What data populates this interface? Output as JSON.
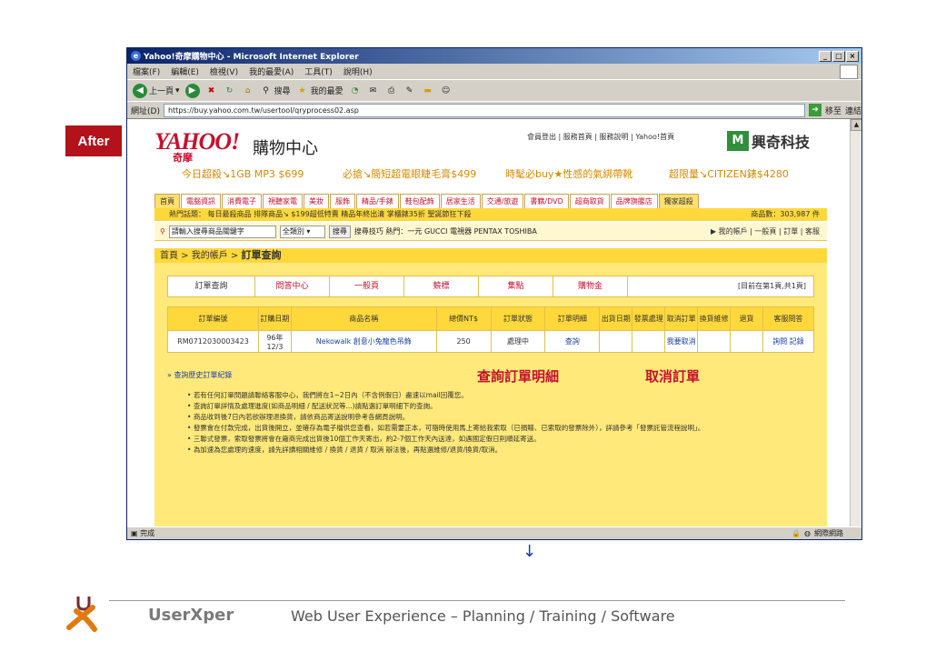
{
  "badge": "After",
  "window": {
    "title": "Yahoo!奇摩購物中心 - Microsoft Internet Explorer",
    "menu": [
      "檔案(F)",
      "編輯(E)",
      "檢視(V)",
      "我的最愛(A)",
      "工具(T)",
      "說明(H)"
    ],
    "toolbar": {
      "back": "上一頁",
      "search": "搜尋",
      "favorites": "我的最愛"
    },
    "address_label": "網址(D)",
    "address": "https://buy.yahoo.com.tw/usertool/qryprocess02.asp",
    "go": "移至",
    "links": "連結",
    "status": "完成",
    "zone": "網際網路"
  },
  "site": {
    "logo": "YAHOO!",
    "logo_sub": "奇摩",
    "title": "購物中心",
    "top_links": "會員登出 | 服務首頁 | 服務說明 | Yahoo!首頁",
    "partner": "興奇科技",
    "promos": [
      "今日超殺↘1GB MP3 $699",
      "必搶↘簡短超電眼睫毛膏$499",
      "時髦必buy★性感的氣綁帶靴",
      "超限量↘CITIZEN錶$4280"
    ],
    "tabs": [
      "首頁",
      "電腦資訊",
      "消費電子",
      "視聽家電",
      "美妝",
      "服飾",
      "精品/手錶",
      "鞋包配飾",
      "居家生活",
      "交通/旅遊",
      "書籍/DVD",
      "超商取貨",
      "品牌旗艦店",
      "獨家超殺"
    ],
    "hot_topics": "熱門話題： 每日最殺商品  排隊商品↘  $199超低特賣  精品年終出清  掌櫃錶35折  聖誕節狂下殺",
    "product_count": "商品數：303,987 件",
    "search_placeholder": "請輸入搜尋商品關鍵字",
    "search_category": "全類別",
    "search_button": "搜尋",
    "search_hints": "搜尋技巧  熱門：一元  GUCCI  電視器  PENTAX  TOSHIBA",
    "account_links": "▶ 我的帳戶  |  一般頁  |  訂單  |  客服",
    "breadcrumb_prefix": "首頁 > 我的帳戶 > ",
    "breadcrumb_current": "訂單查詢",
    "subtabs": [
      "訂單查詢",
      "問答中心",
      "一般頁",
      "競標",
      "集點",
      "購物金"
    ],
    "page_info": "[目前在第1頁,共1頁]",
    "table_headers": [
      "訂單編號",
      "訂購日期",
      "商品名稱",
      "總價NT$",
      "訂單狀態",
      "訂單明細",
      "出貨日期",
      "發票處理",
      "取消訂單",
      "換貨維修",
      "退貨",
      "客服問答"
    ],
    "order": {
      "id": "RM0712030003423",
      "date": "96年 12/3",
      "product": "Nekowalk 創意小兔龍色吊飾",
      "total": "250",
      "status": "處理中",
      "detail": "查詢",
      "cancel": "我要取消",
      "service": "詢問  記錄"
    },
    "history_link": "查詢歷史訂單紀錄",
    "callout_detail": "查詢訂單明細",
    "callout_cancel": "取消訂單",
    "notes": [
      "若有任何訂單問題請聯絡客服中心，我們將在1~2日內（不含例假日）盡速以mail回覆您。",
      "查詢訂單詳情及處理進度(如商品明細 / 配送狀況等...)請點選訂單明細下的查詢。",
      "商品收到後7日內若欲辦理退換貨，請依商品寄送說明參考各網頁說明。",
      "發票會在付款完成，出貨後開立，並確存為電子檔供您查看，如若需要正本，可隨時使用馬上寄給我索取（已捐贈、已索取的發票除外），詳請參考「發票託管流程說明」。",
      "三聯式發票，索取發票將會在廠商完成出貨後10個工作天寄出，約2-7個工作天內送達，如遇國定假日則順延寄送。",
      "為加速為您處理的速度，請先詳讀相關維修 / 換貨 / 退貨 / 取消 辦法後，再點選維修/退貨/換貨/取消。"
    ]
  },
  "footer": {
    "brand": "UserXper",
    "tagline": "Web User Experience – Planning / Training / Software"
  }
}
